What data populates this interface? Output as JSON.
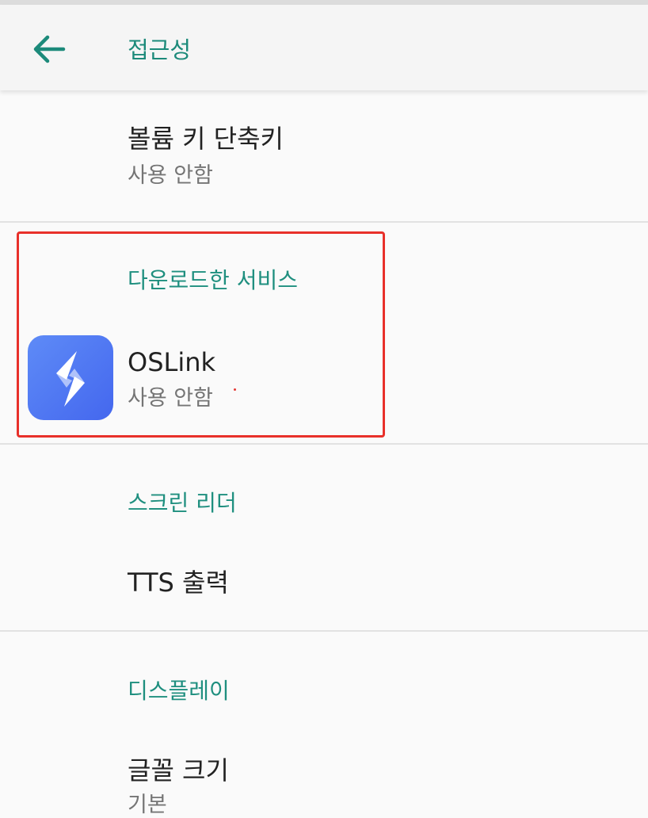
{
  "app_bar": {
    "back_icon": "arrow-back-icon",
    "title": "접근성"
  },
  "colors": {
    "accent": "#1c8a7a",
    "highlight_border": "#e8302a",
    "app_icon_gradient": [
      "#5e8bf7",
      "#4467ee"
    ]
  },
  "volume_shortcut": {
    "title": "볼륨 키 단축키",
    "summary": "사용 안함"
  },
  "downloaded_services": {
    "header": "다운로드한 서비스",
    "items": [
      {
        "icon": "oslink-app-icon",
        "title": "OSLink",
        "summary": "사용 안함"
      }
    ]
  },
  "screen_reader": {
    "header": "스크린 리더",
    "items": [
      {
        "title": "TTS 출력"
      }
    ]
  },
  "display": {
    "header": "디스플레이",
    "items": [
      {
        "title": "글꼴 크기",
        "summary": "기본"
      }
    ]
  }
}
